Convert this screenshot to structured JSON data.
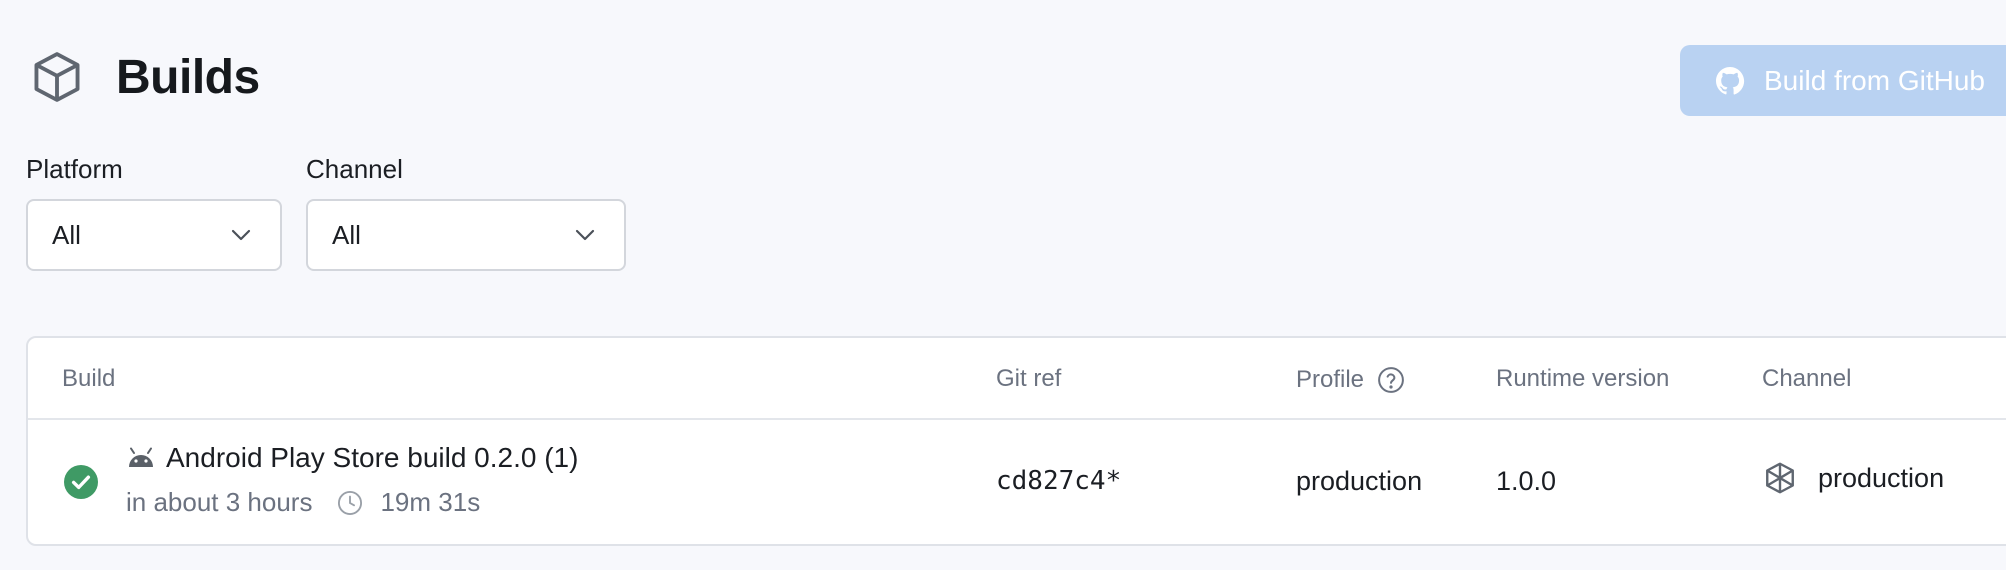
{
  "header": {
    "title": "Builds",
    "icon": "cube-icon",
    "build_button_label": "Build from GitHub",
    "build_button_icon": "github-icon"
  },
  "filters": {
    "platform": {
      "label": "Platform",
      "value": "All"
    },
    "channel": {
      "label": "Channel",
      "value": "All"
    }
  },
  "table": {
    "columns": {
      "build": "Build",
      "git_ref": "Git ref",
      "profile": "Profile",
      "runtime_version": "Runtime version",
      "channel": "Channel"
    },
    "rows": [
      {
        "status": "success",
        "platform_icon": "android-icon",
        "title": "Android Play Store build 0.2.0 (1)",
        "time": "in about 3 hours",
        "duration": "19m 31s",
        "git_ref": "cd827c4*",
        "profile": "production",
        "runtime_version": "1.0.0",
        "channel": "production"
      }
    ]
  },
  "colors": {
    "success": "#3f9a65",
    "button_bg": "#b9d2f2",
    "muted_text": "#6b7280"
  }
}
